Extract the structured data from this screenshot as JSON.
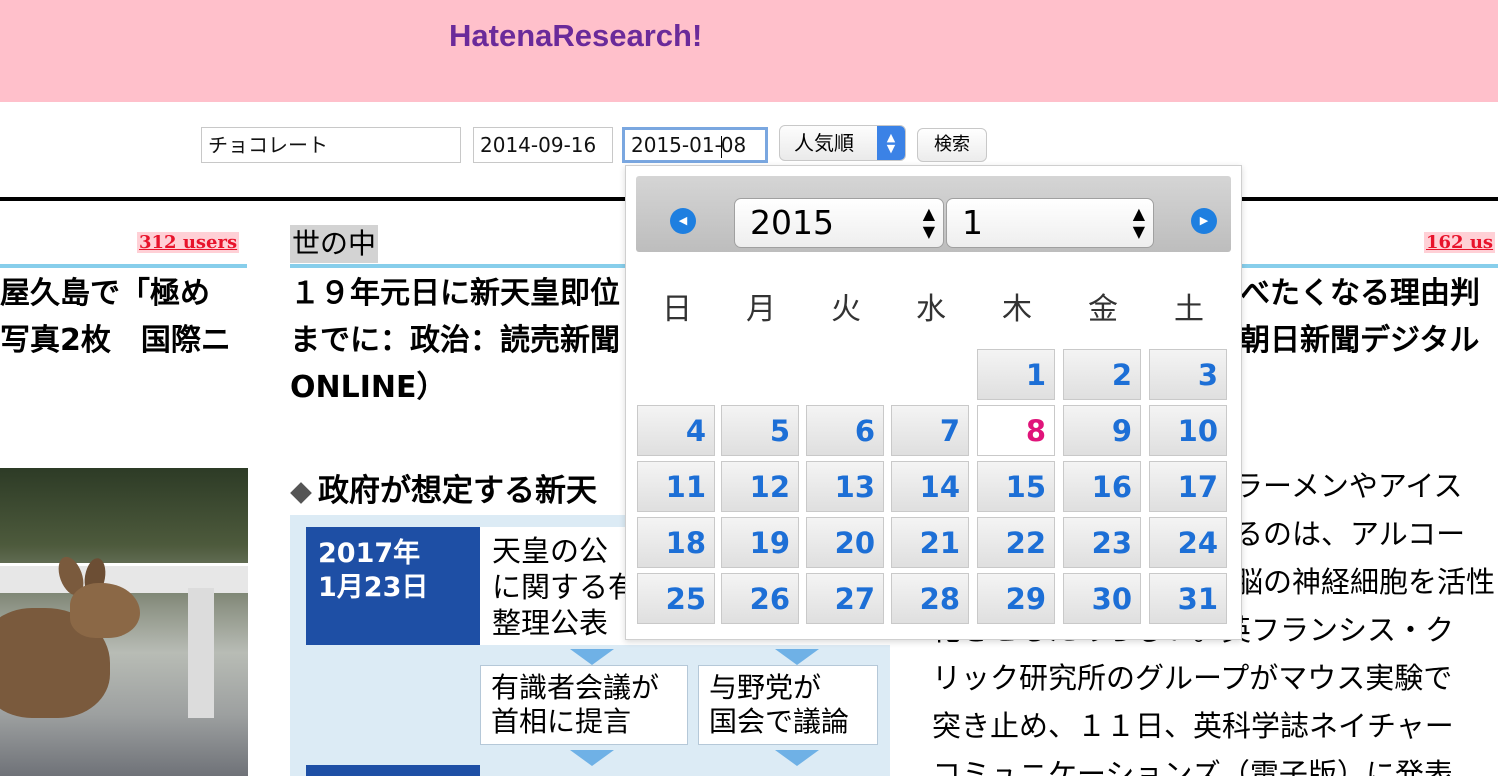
{
  "header": {
    "logo": "HatenaResearch!"
  },
  "search": {
    "keyword": "チョコレート",
    "date_from": "2014-09-16",
    "date_to_before_caret": "2015-01-",
    "date_to_after_caret": "08",
    "sort": "人気順",
    "submit_label": "検索"
  },
  "articles": {
    "left": {
      "users": "312 users",
      "title_line1": "屋久島で「極め",
      "title_line2": "写真2枚　国際ニ"
    },
    "center": {
      "category": "世の中",
      "title_line1": "１９年元日に新天皇即位",
      "title_line2": "までに：政治：読売新聞",
      "title_line3": "ONLINE）"
    },
    "right": {
      "users": "162 us",
      "title_line1": "べたくなる理由判",
      "title_line2": "朝日新聞デジタル"
    }
  },
  "infographic": {
    "title": "政府が想定する新天",
    "date_line1": "2017年",
    "date_line2": "1月23日",
    "box1_line1": "天皇の公",
    "box1_line2": "に関する有",
    "box1_line3": "整理公表",
    "box2_line1": "有識者会議が",
    "box2_line2": "首相に提言",
    "box3_line1": "与野党が",
    "box3_line2": "国会で議論"
  },
  "body_text": {
    "line1": "ラーメンやアイス",
    "line2": "るのは、アルコー",
    "line3": "脳の神経細胞を活性",
    "line4": "化させるためらしい。英フランシス・ク",
    "line5": "リック研究所のグループがマウス実験で",
    "line6": "突き止め、１１日、英科学誌ネイチャー",
    "line7": "コミュニケーションズ（電子版）に発表"
  },
  "calendar": {
    "year": "2015",
    "month": "1",
    "weekdays": [
      "日",
      "月",
      "火",
      "水",
      "木",
      "金",
      "土"
    ],
    "first_weekday_index": 4,
    "days": [
      "1",
      "2",
      "3",
      "4",
      "5",
      "6",
      "7",
      "8",
      "9",
      "10",
      "11",
      "12",
      "13",
      "14",
      "15",
      "16",
      "17",
      "18",
      "19",
      "20",
      "21",
      "22",
      "23",
      "24",
      "25",
      "26",
      "27",
      "28",
      "29",
      "30",
      "31"
    ],
    "selected_day": "8",
    "colors": {
      "day_text": "#1d6fd6",
      "today_text": "#e0147a",
      "nav": "#1e7fe0"
    }
  }
}
